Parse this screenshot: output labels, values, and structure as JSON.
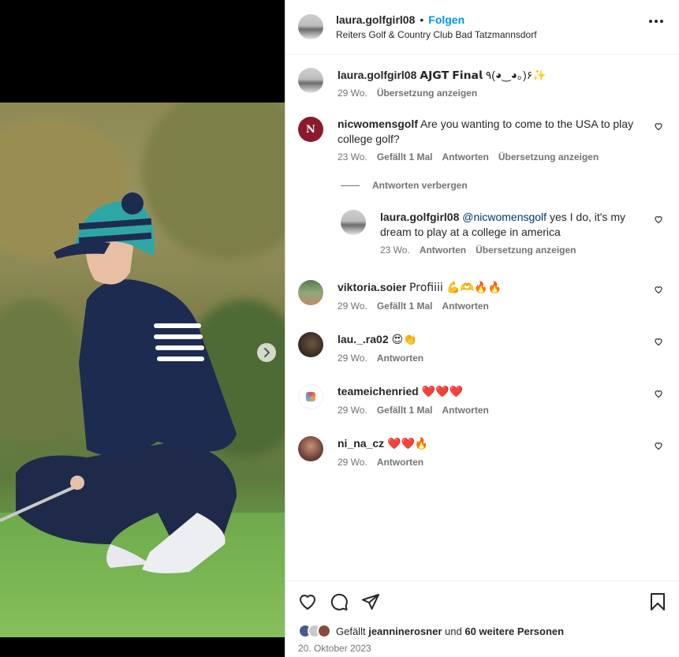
{
  "post": {
    "username": "laura.golfgirl08",
    "follow_label": "Folgen",
    "separator": "•",
    "location": "Reiters Golf & Country Club Bad Tatzmannsdorf"
  },
  "caption": {
    "username": "laura.golfgirl08",
    "text": "𝗔𝗝𝗚𝗧 𝗙𝗶𝗻𝗮𝗹 ٩(◕‿◕｡)۶✨",
    "time": "29 Wo.",
    "translate": "Übersetzung anzeigen"
  },
  "comments": [
    {
      "username": "nicwomensgolf",
      "text": "Are you wanting to come to the USA to play college golf?",
      "time": "23 Wo.",
      "likes": "Gefällt 1 Mal",
      "reply": "Antworten",
      "translate": "Übersetzung anzeigen"
    },
    {
      "username": "viktoria.soier",
      "text": "Profiiii 💪🫶🔥🔥",
      "time": "29 Wo.",
      "likes": "Gefällt 1 Mal",
      "reply": "Antworten"
    },
    {
      "username": "lau._.ra02",
      "text": "😍👏",
      "time": "29 Wo.",
      "reply": "Antworten"
    },
    {
      "username": "teameichenried",
      "text": "❤️❤️❤️",
      "time": "29 Wo.",
      "likes": "Gefällt 1 Mal",
      "reply": "Antworten"
    },
    {
      "username": "ni_na_cz",
      "text": "❤️❤️🔥",
      "time": "29 Wo.",
      "reply": "Antworten"
    }
  ],
  "hide_replies": "Antworten verbergen",
  "reply_item": {
    "username": "laura.golfgirl08",
    "mention": "@nicwomensgolf",
    "text": "yes I do, it's my dream to play at a college in america",
    "time": "23 Wo.",
    "reply": "Antworten",
    "translate": "Übersetzung anzeigen"
  },
  "footer": {
    "likes_prefix": "Gefällt",
    "liked_by": "jeanninerosner",
    "likes_connector": "und",
    "likes_others": "60 weitere Personen",
    "date": "20. Oktober 2023"
  },
  "icons": {
    "more": "more-options-icon",
    "like": "heart-icon",
    "comment": "comment-icon",
    "share": "share-icon",
    "save": "bookmark-icon",
    "next": "chevron-right-icon"
  }
}
